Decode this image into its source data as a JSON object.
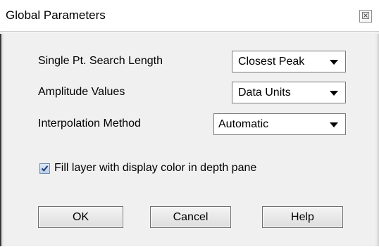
{
  "window": {
    "title": "Global Parameters"
  },
  "fields": [
    {
      "label": "Single Pt. Search Length",
      "value": "Closest Peak"
    },
    {
      "label": "Amplitude Values",
      "value": "Data Units"
    },
    {
      "label": "Interpolation Method",
      "value": "Automatic"
    }
  ],
  "fill_option": {
    "label": "Fill layer with display color in depth pane",
    "checked": true
  },
  "buttons": {
    "ok": "OK",
    "cancel": "Cancel",
    "help": "Help"
  }
}
